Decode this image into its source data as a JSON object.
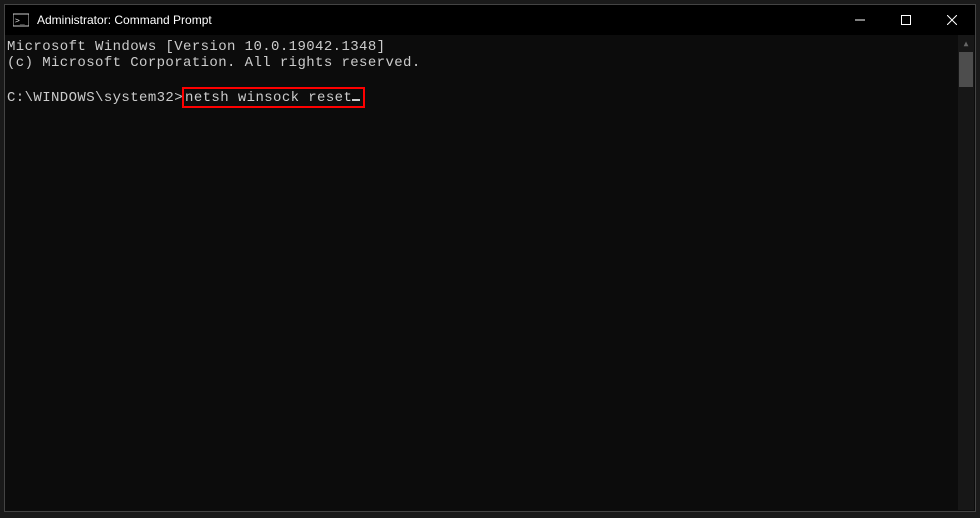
{
  "titlebar": {
    "title": "Administrator: Command Prompt"
  },
  "terminal": {
    "line1": "Microsoft Windows [Version 10.0.19042.1348]",
    "line2": "(c) Microsoft Corporation. All rights reserved.",
    "prompt_path": "C:\\WINDOWS\\system32>",
    "command": "netsh winsock reset"
  }
}
